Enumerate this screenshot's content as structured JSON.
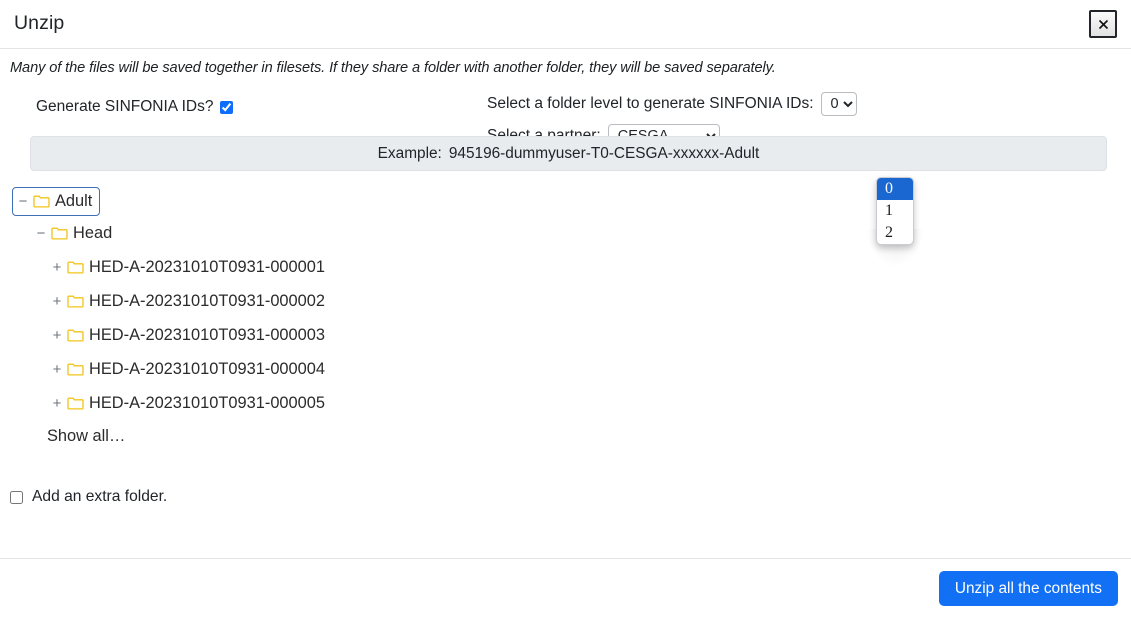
{
  "header": {
    "title": "Unzip",
    "close_icon": "close-icon"
  },
  "body": {
    "note": "Many of the files will be saved together in filesets. If they share a folder with another folder, they will be saved separately.",
    "generate_ids": {
      "label": "Generate SINFONIA IDs?",
      "checked": true
    },
    "folder_level": {
      "label": "Select a folder level to generate SINFONIA IDs:",
      "value": "0",
      "options": [
        "0",
        "1",
        "2"
      ],
      "open": true
    },
    "partner": {
      "label": "Select a partner:",
      "value": "CESGA",
      "options": [
        "CESGA"
      ]
    },
    "example": {
      "label": "Example:",
      "value": "945196-dummyuser-T0-CESGA-xxxxxx-Adult"
    },
    "tree": [
      {
        "toggle": "−",
        "label": "Adult",
        "level": 0,
        "root": true
      },
      {
        "toggle": "−",
        "label": "Head",
        "level": 1,
        "root": false
      },
      {
        "toggle": "+",
        "label": "HED-A-20231010T0931-000001",
        "level": 2,
        "root": false
      },
      {
        "toggle": "+",
        "label": "HED-A-20231010T0931-000002",
        "level": 2,
        "root": false
      },
      {
        "toggle": "+",
        "label": "HED-A-20231010T0931-000003",
        "level": 2,
        "root": false
      },
      {
        "toggle": "+",
        "label": "HED-A-20231010T0931-000004",
        "level": 2,
        "root": false
      },
      {
        "toggle": "+",
        "label": "HED-A-20231010T0931-000005",
        "level": 2,
        "root": false
      }
    ],
    "show_all": "Show all…",
    "extra_folder": {
      "label": "Add an extra folder.",
      "checked": false
    }
  },
  "footer": {
    "submit_label": "Unzip all the contents"
  },
  "colors": {
    "primary": "#1170f4",
    "folder": "#f5c518",
    "highlight": "#1a67d2",
    "example_bg": "#e9ecef",
    "focus_border": "#3d6fb5"
  }
}
